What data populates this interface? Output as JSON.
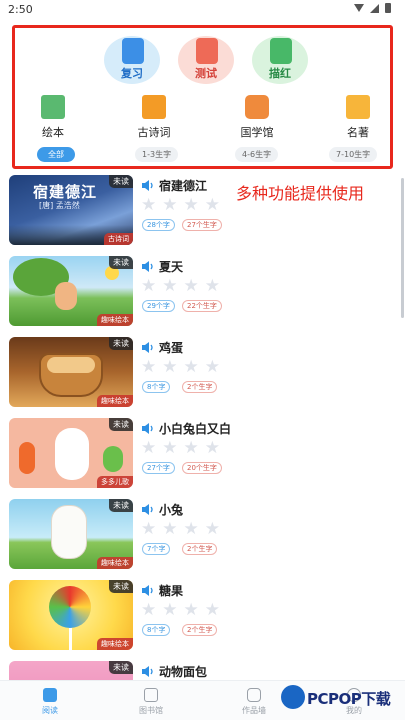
{
  "status_bar": {
    "time": "2:50"
  },
  "feature_panel": {
    "top_buttons": [
      {
        "label": "复习",
        "icon": "review-card-icon"
      },
      {
        "label": "测试",
        "icon": "test-paper-icon"
      },
      {
        "label": "描红",
        "icon": "pen-trace-icon"
      }
    ],
    "categories": [
      {
        "label": "绘本",
        "icon": "picture-book-icon"
      },
      {
        "label": "古诗词",
        "icon": "poem-book-icon"
      },
      {
        "label": "国学馆",
        "icon": "classic-wen-icon"
      },
      {
        "label": "名著",
        "icon": "open-book-icon"
      }
    ],
    "filters": [
      "全部",
      "1-3生字",
      "4-6生字",
      "7-10生字"
    ]
  },
  "promo_text": "多种功能提供使用",
  "books": [
    {
      "title": "宿建德江",
      "words": "28个字",
      "new_chars": "27个生字",
      "badge": "未读",
      "genre": "古诗词",
      "cover_text": "宿建德江",
      "cover_sub": "[唐] 孟浩然"
    },
    {
      "title": "夏天",
      "words": "29个字",
      "new_chars": "22个生字",
      "badge": "未读",
      "genre": "趣味绘本"
    },
    {
      "title": "鸡蛋",
      "words": "8个字",
      "new_chars": "2个生字",
      "badge": "未读",
      "genre": "趣味绘本"
    },
    {
      "title": "小白兔白又白",
      "words": "27个字",
      "new_chars": "20个生字",
      "badge": "未读",
      "genre": "多多儿歌"
    },
    {
      "title": "小兔",
      "words": "7个字",
      "new_chars": "2个生字",
      "badge": "未读",
      "genre": "趣味绘本"
    },
    {
      "title": "糖果",
      "words": "8个字",
      "new_chars": "2个生字",
      "badge": "未读",
      "genre": "趣味绘本"
    },
    {
      "title": "动物面包",
      "badge": "未读"
    }
  ],
  "bottom_nav": [
    {
      "label": "阅读",
      "icon": "read-icon"
    },
    {
      "label": "图书馆",
      "icon": "library-icon"
    },
    {
      "label": "作品墙",
      "icon": "works-wall-icon"
    },
    {
      "label": "我的",
      "icon": "profile-icon"
    }
  ],
  "watermark": {
    "text": "PCPOP下载"
  }
}
